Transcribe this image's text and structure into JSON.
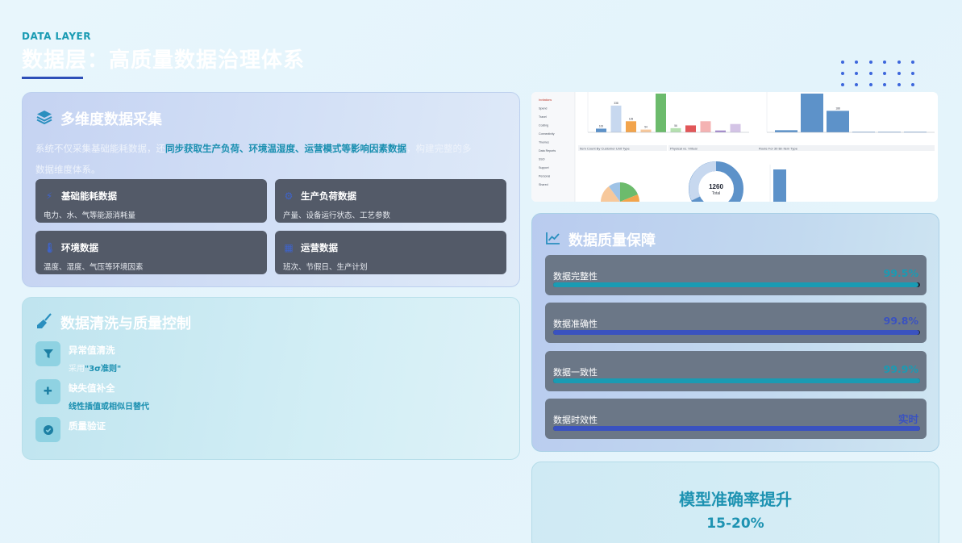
{
  "header": {
    "eyebrow": "DATA LAYER",
    "title": "数据层：高质量数据治理体系"
  },
  "colors": {
    "accent_teal": "#1a9bb3",
    "accent_blue": "#2d4fb8",
    "card_bg": "#535a68",
    "quality_row_bg": "#6b7787"
  },
  "collection": {
    "icon": "layers-icon",
    "title": "多维度数据采集",
    "desc_prefix": "系统不仅采集基础能耗数据，还",
    "desc_highlight": "同步获取生产负荷、环境温湿度、运营模式等影响因素数据",
    "desc_suffix": "，构建完整的多",
    "desc_line2": "数据维度体系。",
    "cards": [
      {
        "icon": "bolt-icon",
        "title": "基础能耗数据",
        "desc": "电力、水、气等能源消耗量"
      },
      {
        "icon": "gear-icon",
        "title": "生产负荷数据",
        "desc": "产量、设备运行状态、工艺参数"
      },
      {
        "icon": "thermometer-icon",
        "title": "环境数据",
        "desc": "温度、湿度、气压等环境因素"
      },
      {
        "icon": "calendar-icon",
        "title": "运营数据",
        "desc": "班次、节假日、生产计划"
      }
    ]
  },
  "cleaning": {
    "icon": "broom-icon",
    "title": "数据清洗与质量控制",
    "items": [
      {
        "icon": "filter-icon",
        "title": "异常值清洗",
        "desc_prefix": "采用",
        "desc_highlight": "\"3σ准则\"",
        "desc_suffix": ""
      },
      {
        "icon": "puzzle-icon",
        "title": "缺失值补全",
        "desc_prefix": "",
        "desc_highlight": "线性插值或相似日替代",
        "desc_suffix": ""
      },
      {
        "icon": "check-icon",
        "title": "质量验证",
        "desc_prefix": "",
        "desc_highlight": "",
        "desc_suffix": ""
      }
    ]
  },
  "quality": {
    "icon": "line-chart-icon",
    "title": "数据质量保障",
    "metrics": [
      {
        "label": "数据完整性",
        "value": "99.5%",
        "fill": 0.995,
        "color": "#1a9bb3"
      },
      {
        "label": "数据准确性",
        "value": "99.8%",
        "fill": 0.998,
        "color": "#3a52c0"
      },
      {
        "label": "数据一致性",
        "value": "99.9%",
        "fill": 0.999,
        "color": "#1a9bb3"
      },
      {
        "label": "数据时效性",
        "value": "实时",
        "fill": 1.0,
        "color": "#3a52c0"
      }
    ]
  },
  "result": {
    "title": "模型准确率提升",
    "value": "15-20%"
  },
  "dashboard": {
    "nav": [
      "Invitations",
      "Spend",
      "Travel",
      "Costing",
      "Connectivity",
      "Themes",
      "Data Reports",
      "SSO",
      "Support",
      "Personal",
      "Shared"
    ],
    "bar_top_left_values": [
      40,
      290,
      120,
      30,
      420,
      45,
      75,
      120,
      20,
      90
    ],
    "bar_top_left_labels": [
      "100",
      "338",
      "128",
      "54",
      "",
      "56",
      "",
      "",
      "",
      ""
    ],
    "bar_top_right_values": [
      22,
      400,
      222,
      5,
      5,
      5
    ],
    "bar_top_right_labels": [
      "",
      "",
      "188",
      "",
      "",
      ""
    ],
    "pie_center_value": "1260",
    "pie_center_label": "Total",
    "pie_title": "Physical vs. Virtual",
    "mid_title": "Item Count By Customer Unit Type",
    "right_title": "Route For 30 Bn Item Type"
  }
}
